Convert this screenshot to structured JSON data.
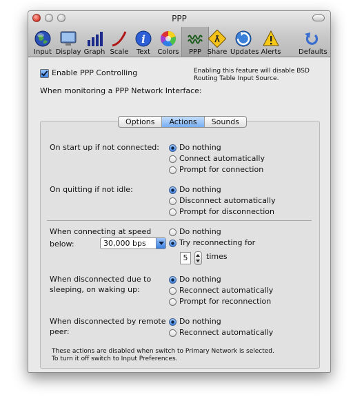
{
  "window": {
    "title": "PPP"
  },
  "toolbar": {
    "items": [
      {
        "label": "Input",
        "icon": "globe-icon"
      },
      {
        "label": "Display",
        "icon": "monitor-icon"
      },
      {
        "label": "Graph",
        "icon": "bar-graph-icon"
      },
      {
        "label": "Scale",
        "icon": "scale-curve-icon"
      },
      {
        "label": "Text",
        "icon": "info-icon"
      },
      {
        "label": "Colors",
        "icon": "color-wheel-icon"
      },
      {
        "label": "PPP",
        "icon": "ppp-wave-icon"
      },
      {
        "label": "Share",
        "icon": "share-sign-icon"
      },
      {
        "label": "Updates",
        "icon": "updates-globe-icon"
      },
      {
        "label": "Alerts",
        "icon": "alert-triangle-icon"
      },
      {
        "label": "Defaults",
        "icon": "reset-arrow-icon"
      }
    ],
    "selected": "PPP"
  },
  "enable": {
    "label": "Enable PPP Controlling",
    "checked": true,
    "note_line1": "Enabling this feature will disable BSD",
    "note_line2": "Routing Table Input Source."
  },
  "monitor_heading": "When monitoring a PPP Network Interface:",
  "tabs": [
    {
      "label": "Options",
      "active": false
    },
    {
      "label": "Actions",
      "active": true
    },
    {
      "label": "Sounds",
      "active": false
    }
  ],
  "sections": {
    "startup": {
      "label": "On start up if not connected:",
      "options": [
        "Do nothing",
        "Connect automatically",
        "Prompt for connection"
      ],
      "selected": 0
    },
    "quitting": {
      "label": "On quitting if not idle:",
      "options": [
        "Do nothing",
        "Disconnect automatically",
        "Prompt for disconnection"
      ],
      "selected": 0
    },
    "speed": {
      "label_line1": "When connecting at speed",
      "label_line2": "below:",
      "popup_value": "30,000 bps",
      "options": [
        "Do nothing",
        "Try reconnecting for"
      ],
      "selected": 1,
      "times_value": "5",
      "times_label": "times"
    },
    "sleep": {
      "label_line1": "When disconnected due to",
      "label_line2": "sleeping, on waking up:",
      "options": [
        "Do nothing",
        "Reconnect automatically",
        "Prompt for reconnection"
      ],
      "selected": 0
    },
    "remote": {
      "label_line1": "When disconnected by remote",
      "label_line2": "peer:",
      "options": [
        "Do nothing",
        "Reconnect automatically"
      ],
      "selected": 0
    }
  },
  "footer": {
    "line1": "These actions are disabled when switch to Primary Network is selected.",
    "line2": "To turn it off switch to Input Preferences."
  }
}
